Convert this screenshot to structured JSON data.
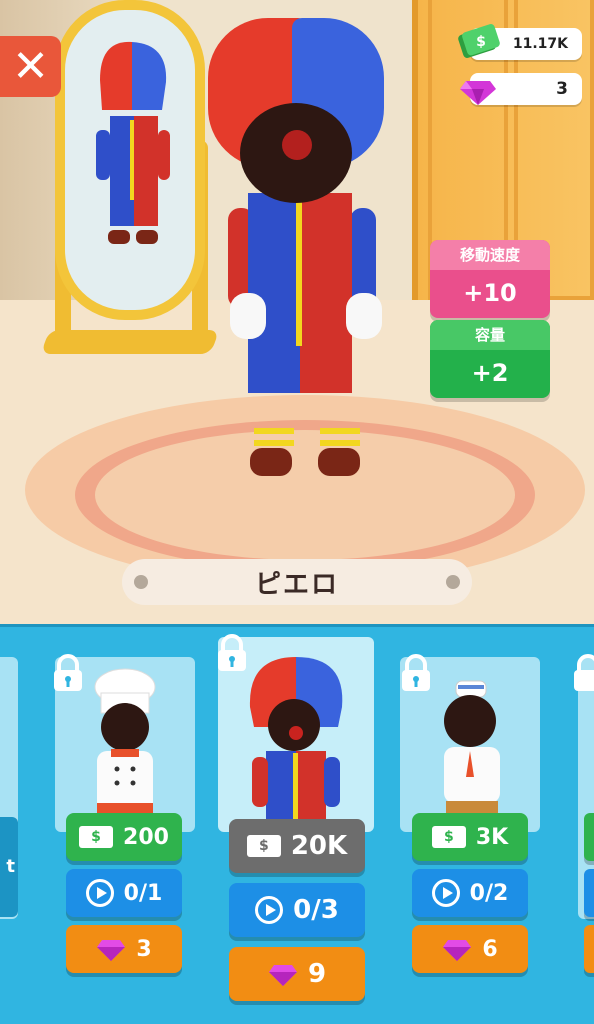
{
  "currency": {
    "cash": "11.17K",
    "gems": "3"
  },
  "stats": [
    {
      "label": "移動速度",
      "value": "+10"
    },
    {
      "label": "容量",
      "value": "+2"
    }
  ],
  "character_name": "ピエロ",
  "shop": {
    "side_tab_label": "t",
    "items": [
      {
        "price": "200",
        "ads": "0/1",
        "gems": "3"
      },
      {
        "price": "20K",
        "ads": "0/3",
        "gems": "9"
      },
      {
        "price": "3K",
        "ads": "0/2",
        "gems": "6"
      }
    ]
  },
  "colors": {
    "cash_button": "#2fb34d",
    "ad_button": "#1d8fe6",
    "gem_button": "#f28d13",
    "shop_bg": "#30b5e1"
  }
}
